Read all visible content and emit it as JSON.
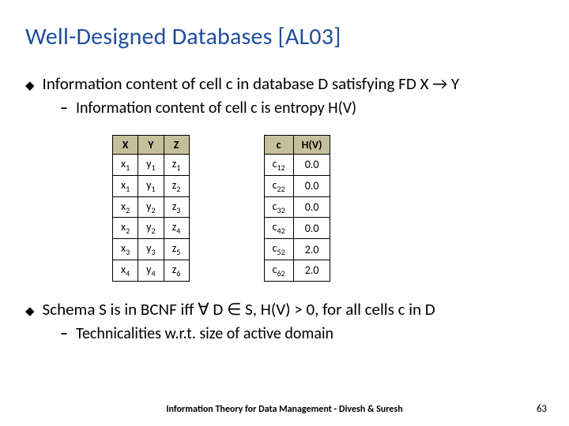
{
  "title": "Well-Designed Databases [AL03]",
  "bullet1": "Information content of cell c in database D satisfying FD X → Y",
  "sub1": "Information content of cell c is entropy H(V)",
  "bullet2": "Schema S is in BCNF iff ∀ D ∈ S, H(V) > 0, for all cells c in D",
  "sub2": "Technicalities w.r.t. size of active domain",
  "footer": "Information Theory for Data Management - Divesh & Suresh",
  "pagenum": "63",
  "table1": {
    "headers": [
      "X",
      "Y",
      "Z"
    ],
    "rows": [
      [
        "x1",
        "y1",
        "z1"
      ],
      [
        "x1",
        "y1",
        "z2"
      ],
      [
        "x2",
        "y2",
        "z3"
      ],
      [
        "x2",
        "y2",
        "z4"
      ],
      [
        "x3",
        "y3",
        "z5"
      ],
      [
        "x4",
        "y4",
        "z6"
      ]
    ]
  },
  "table2": {
    "headers": [
      "c",
      "H(V)"
    ],
    "rows": [
      [
        "c12",
        "0.0"
      ],
      [
        "c22",
        "0.0"
      ],
      [
        "c32",
        "0.0"
      ],
      [
        "c42",
        "0.0"
      ],
      [
        "c52",
        "2.0"
      ],
      [
        "c62",
        "2.0"
      ]
    ]
  }
}
